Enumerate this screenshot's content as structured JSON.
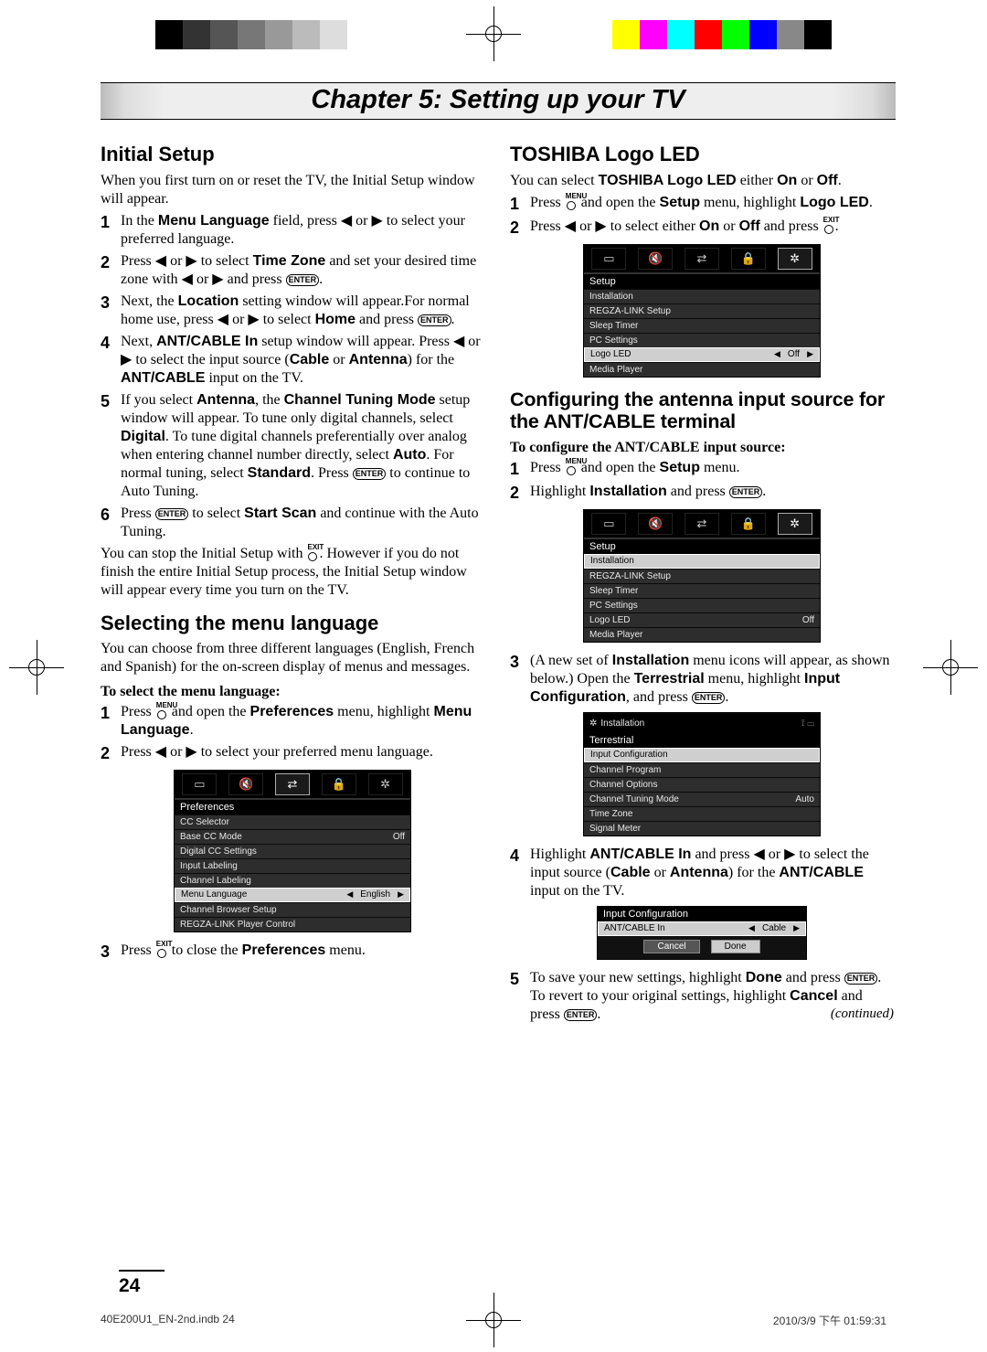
{
  "chapter": "Chapter 5: Setting up your TV",
  "pageNumber": "24",
  "left": {
    "h_initial": "Initial Setup",
    "p_initial": "When you first turn on or reset the TV, the Initial Setup window will appear.",
    "steps_initial": [
      "In the <b>Menu Language</b> field, press ◀ or ▶ to select  your preferred language.",
      "Press ◀ or ▶ to select <b>Time Zone</b> and set your desired time zone with  ◀ or ▶ and press [ENTER].",
      "Next, the <b>Location</b> setting window will appear.For normal home use, press ◀ or ▶ to select <b>Home</b> and press [ENTER].",
      "Next, <b>ANT/CABLE In</b> setup window will appear. Press ◀ or ▶ to select the input source (<b>Cable</b> or <b>Antenna</b>) for the <b>ANT/CABLE</b> input on the TV.",
      "If you select <b>Antenna</b>, the <b>Channel Tuning Mode</b> setup window will appear. To tune only digital channels, select <b>Digital</b>. To tune digital channels preferentially over analog when entering channel number directly, select <b>Auto</b>. For normal tuning, select <b>Standard</b>. Press [ENTER] to continue to Auto Tuning.",
      "Press [ENTER] to select <b>Start Scan</b> and continue with the Auto Tuning."
    ],
    "p_initial_stop": "You can stop the Initial Setup with [EXIT]. However if you do not finish the entire Initial Setup process, the Initial Setup window will appear every time you turn on the TV.",
    "h_lang": "Selecting the menu language",
    "p_lang": "You can choose from three different languages (English, French and Spanish) for the on-screen display of menus and messages.",
    "sub_lang": "To select the menu language:",
    "steps_lang1": [
      "Press [MENU] and open the <b>Preferences</b> menu, highlight <b>Menu Language</b>.",
      "Press ◀ or ▶ to select your preferred menu language."
    ],
    "step_lang_close": "Press [EXIT] to close the <b>Preferences</b> menu.",
    "osd_pref": {
      "title": "Preferences",
      "rows": [
        [
          "CC Selector",
          ""
        ],
        [
          "Base CC Mode",
          "Off"
        ],
        [
          "Digital CC Settings",
          ""
        ],
        [
          "Input Labeling",
          ""
        ],
        [
          "Channel Labeling",
          ""
        ],
        [
          "Menu Language",
          "English"
        ],
        [
          "Channel Browser Setup",
          ""
        ],
        [
          "REGZA-LINK Player Control",
          ""
        ]
      ],
      "highlightIndex": 5
    }
  },
  "right": {
    "h_logo": "TOSHIBA Logo LED",
    "p_logo": "You can select <b>TOSHIBA Logo LED</b> either <b>On</b> or <b>Off</b>.",
    "steps_logo": [
      "Press [MENU] and open the <b>Setup</b> menu, highlight <b>Logo LED</b>.",
      "Press ◀ or ▶ to select either <b>On</b> or <b>Off</b> and press [EXIT]."
    ],
    "osd_setup1": {
      "title": "Setup",
      "rows": [
        [
          "Installation",
          ""
        ],
        [
          "REGZA-LINK Setup",
          ""
        ],
        [
          "Sleep Timer",
          ""
        ],
        [
          "PC Settings",
          ""
        ],
        [
          "Logo LED",
          "Off"
        ],
        [
          "Media Player",
          ""
        ]
      ],
      "highlightIndex": 4
    },
    "h_ant": "Configuring the antenna input source for the ANT/CABLE terminal",
    "sub_ant": "To configure the ANT/CABLE input source:",
    "steps_ant1": [
      "Press [MENU] and open the <b>Setup</b> menu.",
      "Highlight <b>Installation</b> and press [ENTER]."
    ],
    "osd_setup2": {
      "title": "Setup",
      "rows": [
        [
          "Installation",
          ""
        ],
        [
          "REGZA-LINK Setup",
          ""
        ],
        [
          "Sleep Timer",
          ""
        ],
        [
          "PC Settings",
          ""
        ],
        [
          "Logo LED",
          "Off"
        ],
        [
          "Media Player",
          ""
        ]
      ],
      "highlightIndex": 0
    },
    "step_ant3": "(A new set of <b>Installation</b> menu icons will appear, as shown below.) Open the <b>Terrestrial</b> menu, highlight <b>Input Configuration</b>, and press [ENTER].",
    "osd_install": {
      "header": "Installation",
      "title": "Terrestrial",
      "rows": [
        [
          "Input Configuration",
          ""
        ],
        [
          "Channel Program",
          ""
        ],
        [
          "Channel Options",
          ""
        ],
        [
          "Channel Tuning Mode",
          "Auto"
        ],
        [
          "Time Zone",
          ""
        ],
        [
          "Signal Meter",
          ""
        ]
      ],
      "highlightIndex": 0
    },
    "step_ant4": "Highlight <b>ANT/CABLE In</b> and press ◀ or ▶ to select the input source (<b>Cable</b> or <b>Antenna</b>) for the <b>ANT/CABLE</b> input on the TV.",
    "osd_inputcfg": {
      "title": "Input Configuration",
      "rows": [
        [
          "ANT/CABLE In",
          "Cable"
        ]
      ],
      "highlightIndex": 0,
      "buttons": [
        "Cancel",
        "Done"
      ]
    },
    "step_ant5": "To save your new settings, highlight <b>Done</b> and press [ENTER]. To revert to your original settings, highlight <b>Cancel</b> and press [ENTER].",
    "continued": "(continued)"
  },
  "footer": {
    "file": "40E200U1_EN-2nd.indb   24",
    "ts": "2010/3/9   下午 01:59:31"
  },
  "colors": {
    "bar1": [
      "#000",
      "#333",
      "#555",
      "#777",
      "#999",
      "#bbb",
      "#ddd",
      "#fff"
    ],
    "bar2": [
      "#ffff00",
      "#ff00ff",
      "#00ffff",
      "#ff0000",
      "#00ff00",
      "#0000ff",
      "#888",
      "#000"
    ]
  }
}
